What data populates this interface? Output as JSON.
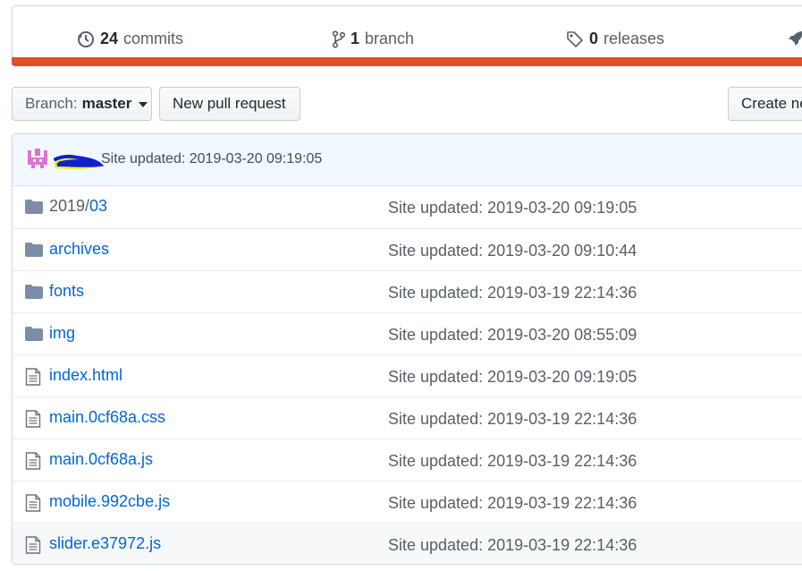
{
  "summary": {
    "commits": {
      "count": "24",
      "label": "commits"
    },
    "branches": {
      "count": "1",
      "label": "branch"
    },
    "releases": {
      "count": "0",
      "label": "releases"
    }
  },
  "toolbar": {
    "branch_prefix": "Branch:",
    "branch_name": "master",
    "new_pull_request": "New pull request",
    "create_new": "Create ne"
  },
  "latest_commit": {
    "message": "Site updated: 2019-03-20 09:19:05"
  },
  "files": [
    {
      "name_prefix": "2019/",
      "name_link": "03",
      "type": "folder",
      "message": "Site updated: 2019-03-20 09:19:05"
    },
    {
      "name_prefix": "",
      "name_link": "archives",
      "type": "folder",
      "message": "Site updated: 2019-03-20 09:10:44"
    },
    {
      "name_prefix": "",
      "name_link": "fonts",
      "type": "folder",
      "message": "Site updated: 2019-03-19 22:14:36"
    },
    {
      "name_prefix": "",
      "name_link": "img",
      "type": "folder",
      "message": "Site updated: 2019-03-20 08:55:09"
    },
    {
      "name_prefix": "",
      "name_link": "index.html",
      "type": "file",
      "message": "Site updated: 2019-03-20 09:19:05"
    },
    {
      "name_prefix": "",
      "name_link": "main.0cf68a.css",
      "type": "file",
      "message": "Site updated: 2019-03-19 22:14:36"
    },
    {
      "name_prefix": "",
      "name_link": "main.0cf68a.js",
      "type": "file",
      "message": "Site updated: 2019-03-19 22:14:36"
    },
    {
      "name_prefix": "",
      "name_link": "mobile.992cbe.js",
      "type": "file",
      "message": "Site updated: 2019-03-19 22:14:36"
    },
    {
      "name_prefix": "",
      "name_link": "slider.e37972.js",
      "type": "file",
      "message": "Site updated: 2019-03-19 22:14:36"
    }
  ],
  "colors": {
    "language_bar": "#e34c26",
    "link": "#0366d6",
    "folder_icon": "#79b8ff"
  }
}
